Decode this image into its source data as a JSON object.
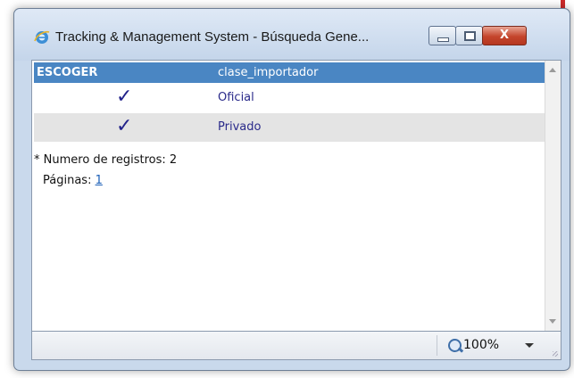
{
  "window": {
    "title": "Tracking & Management System - Búsqueda Gene...",
    "close_label": "X",
    "colors": {
      "header": "#4a86c3",
      "alt_row": "#e4e4e4",
      "annotation": "#cc2a2a"
    }
  },
  "table": {
    "columns": [
      "ESCOGER",
      "clase_importador"
    ],
    "rows": [
      {
        "check": "✓",
        "value": "Oficial"
      },
      {
        "check": "✓",
        "value": "Privado"
      }
    ]
  },
  "footer": {
    "records_label": "* Numero de registros: 2",
    "pages_label": "Páginas:",
    "page_link": "1"
  },
  "statusbar": {
    "zoom": "100%",
    "zoom_icon": "magnifier-plus-icon"
  }
}
